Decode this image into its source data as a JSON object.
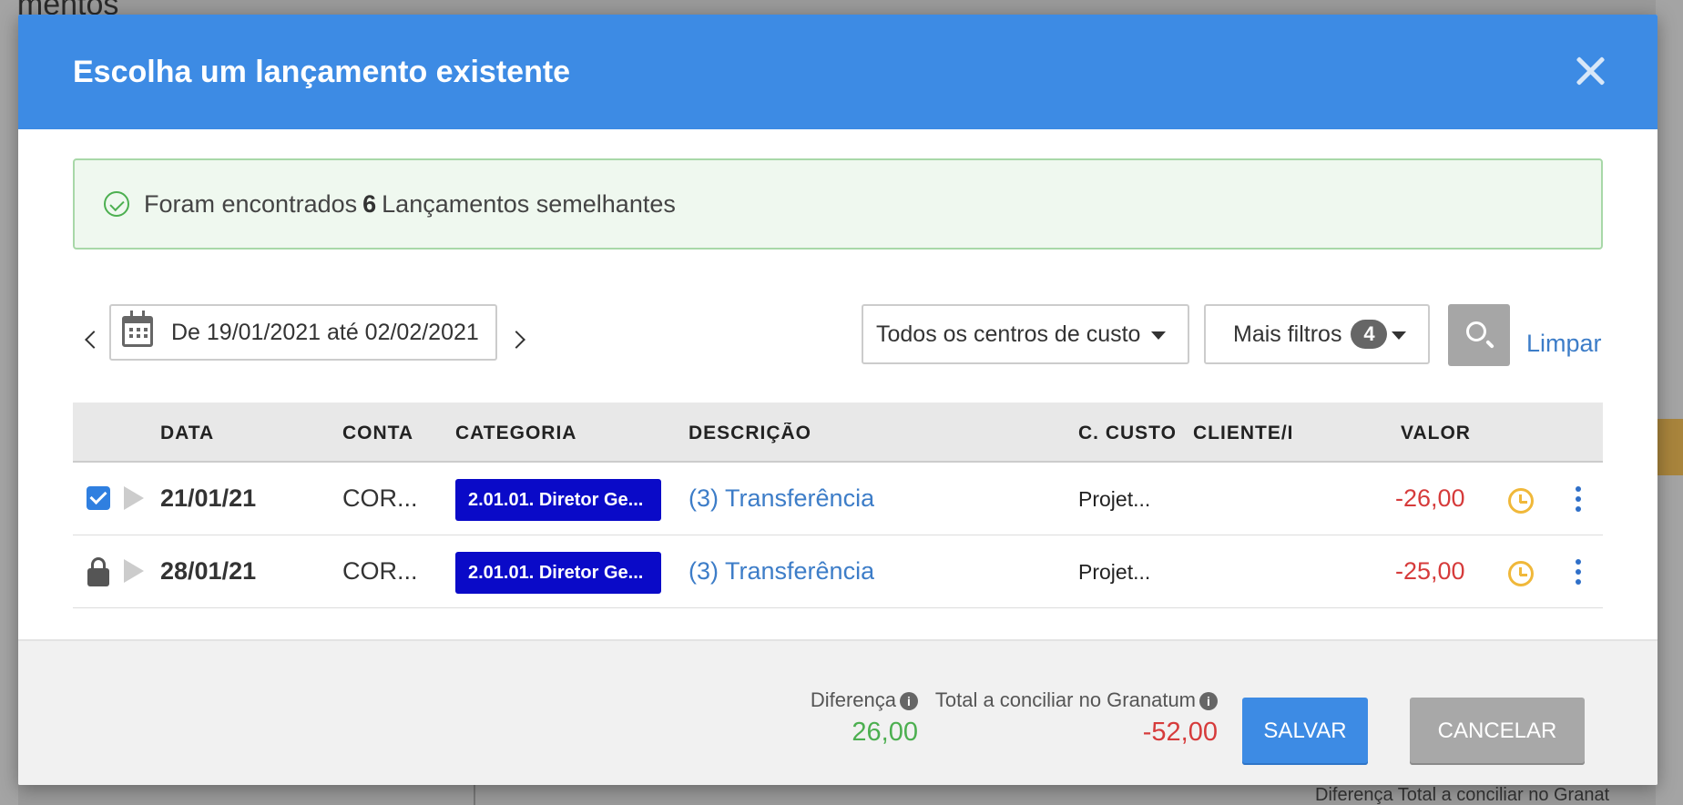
{
  "background": {
    "title_fragment": "amentos",
    "footer_fragment": "Diferença  Total a conciliar no Granat"
  },
  "modal": {
    "title": "Escolha um lançamento existente",
    "alert": {
      "prefix": "Foram encontrados",
      "count": "6",
      "suffix": "Lançamentos semelhantes"
    },
    "filters": {
      "date_range": "De 19/01/2021 até 02/02/2021",
      "cost_center": "Todos os centros de custo",
      "more_filters_label": "Mais filtros",
      "more_filters_count": "4",
      "clear_label": "Limpar"
    },
    "table": {
      "headers": {
        "date": "DATA",
        "account": "CONTA",
        "category": "CATEGORIA",
        "description": "DESCRIÇÃO",
        "cost_center": "C. CUSTO",
        "client": "CLIENTE/F",
        "value": "VALOR"
      },
      "rows": [
        {
          "state": "checked",
          "date": "21/01/21",
          "account": "COR...",
          "category": "2.01.01. Diretor Ge...",
          "description": "(3) Transferência",
          "cost_center": "Projet...",
          "value": "-26,00"
        },
        {
          "state": "locked",
          "date": "28/01/21",
          "account": "COR...",
          "category": "2.01.01. Diretor Ge...",
          "description": "(3) Transferência",
          "cost_center": "Projet...",
          "value": "-25,00"
        }
      ]
    },
    "footer": {
      "difference_label": "Diferença",
      "difference_value": "26,00",
      "total_label": "Total a conciliar no Granatum",
      "total_value": "-52,00",
      "save_label": "SALVAR",
      "cancel_label": "CANCELAR"
    }
  },
  "colors": {
    "header": "#3d8be4",
    "category_tag": "#0a0ac8",
    "negative": "#d63b3b",
    "positive": "#4caf50",
    "link": "#3d7dc8"
  },
  "icons": [
    "close-icon",
    "check-circle-icon",
    "calendar-icon",
    "chevron-left-icon",
    "chevron-right-icon",
    "caret-down-icon",
    "search-icon",
    "checkbox-icon",
    "lock-icon",
    "expand-triangle-icon",
    "clock-icon",
    "more-vertical-icon",
    "info-icon"
  ]
}
